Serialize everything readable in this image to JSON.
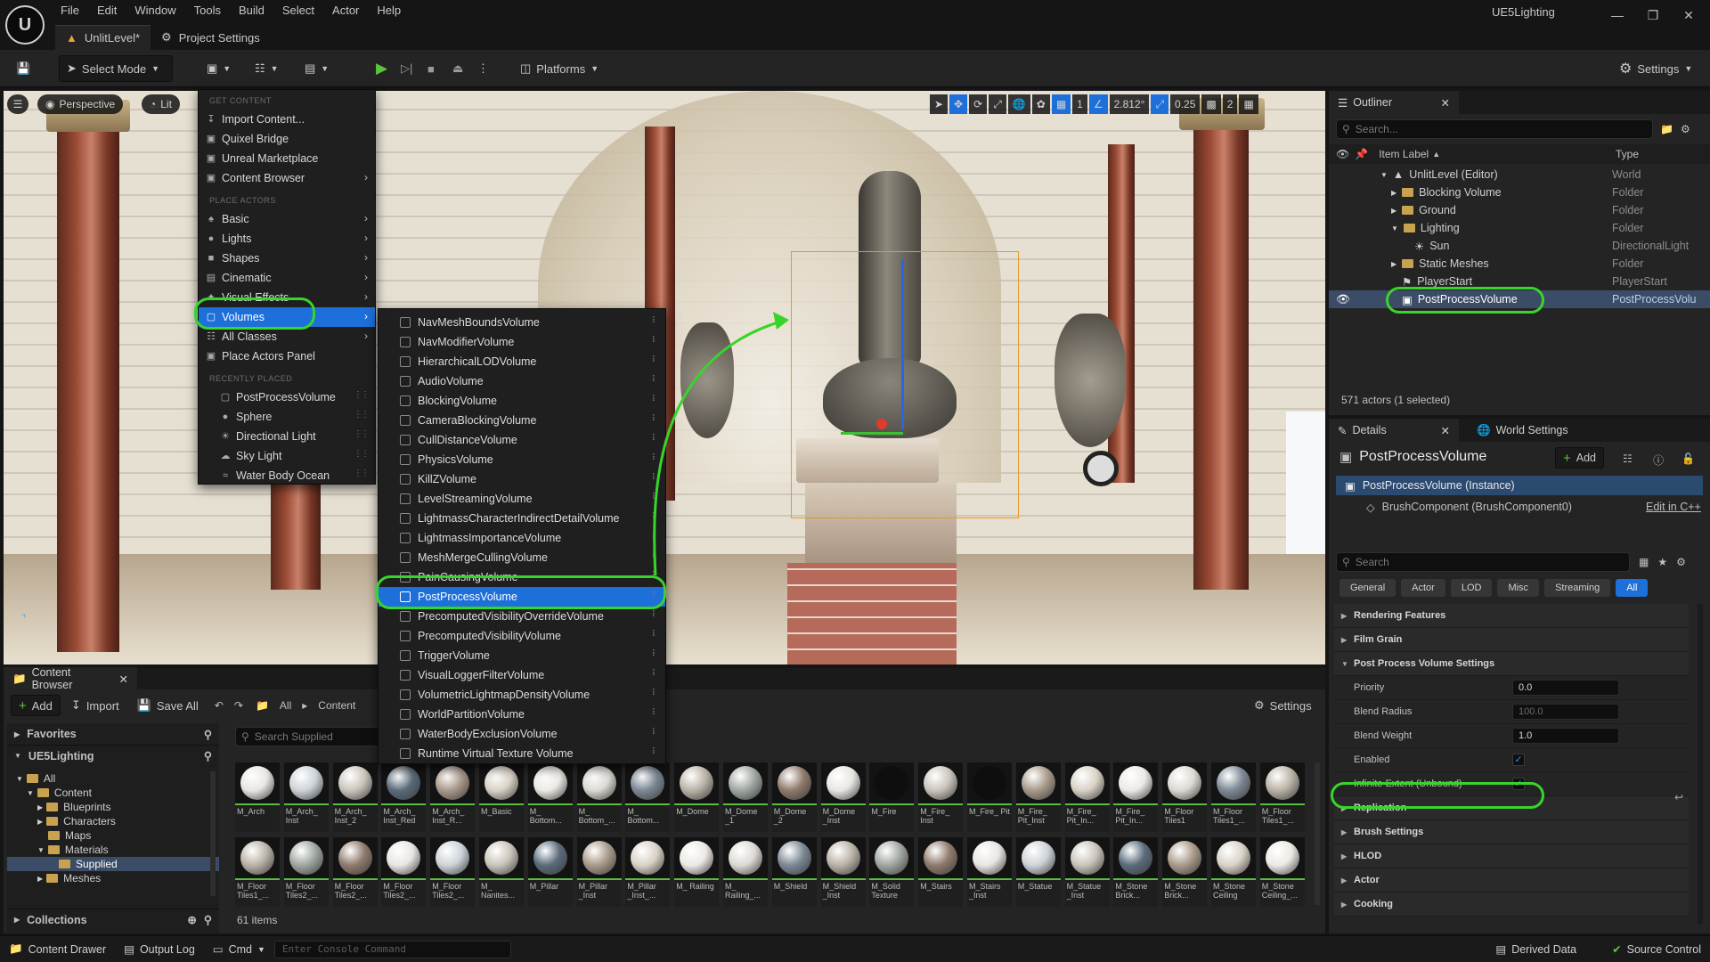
{
  "app": {
    "project_name": "UE5Lighting",
    "menu": [
      "File",
      "Edit",
      "Window",
      "Tools",
      "Build",
      "Select",
      "Actor",
      "Help"
    ],
    "doc_tabs": [
      {
        "label": "UnlitLevel*",
        "icon": "level-icon"
      },
      {
        "label": "Project Settings",
        "icon": "gear-icon"
      }
    ]
  },
  "toolbar": {
    "select_mode": "Select Mode",
    "platforms": "Platforms",
    "settings": "Settings"
  },
  "viewport": {
    "perspective": "Perspective",
    "lit": "Lit",
    "grid_snap": "1",
    "angle_snap": "2.812°",
    "scale_snap": "0.25",
    "camera_speed": "2"
  },
  "place_menu": {
    "section_get_content": "GET CONTENT",
    "get_content_items": [
      {
        "label": "Import Content...",
        "icon": "import-icon"
      },
      {
        "label": "Quixel Bridge",
        "icon": "bridge-icon"
      },
      {
        "label": "Unreal Marketplace",
        "icon": "marketplace-icon"
      },
      {
        "label": "Content Browser",
        "icon": "content-browser-icon"
      }
    ],
    "section_place_actors": "PLACE ACTORS",
    "place_items": [
      {
        "label": "Basic",
        "icon": "basic-icon"
      },
      {
        "label": "Lights",
        "icon": "light-bulb-icon"
      },
      {
        "label": "Shapes",
        "icon": "shapes-icon"
      },
      {
        "label": "Cinematic",
        "icon": "cinematic-icon"
      },
      {
        "label": "Visual Effects",
        "icon": "visual-effects-icon"
      },
      {
        "label": "Volumes",
        "icon": "volume-icon"
      },
      {
        "label": "All Classes",
        "icon": "all-classes-icon"
      },
      {
        "label": "Place Actors Panel",
        "icon": "place-actors-icon"
      }
    ],
    "section_recently_placed": "RECENTLY PLACED",
    "recent_items": [
      {
        "label": "PostProcessVolume",
        "icon": "postprocess-icon"
      },
      {
        "label": "Sphere",
        "icon": "sphere-icon"
      },
      {
        "label": "Directional Light",
        "icon": "directional-light-icon"
      },
      {
        "label": "Sky Light",
        "icon": "sky-light-icon"
      },
      {
        "label": "Water Body Ocean",
        "icon": "water-icon"
      }
    ]
  },
  "volumes_menu": {
    "items": [
      "NavMeshBoundsVolume",
      "NavModifierVolume",
      "HierarchicalLODVolume",
      "AudioVolume",
      "BlockingVolume",
      "CameraBlockingVolume",
      "CullDistanceVolume",
      "PhysicsVolume",
      "KillZVolume",
      "LevelStreamingVolume",
      "LightmassCharacterIndirectDetailVolume",
      "LightmassImportanceVolume",
      "MeshMergeCullingVolume",
      "PainCausingVolume",
      "PostProcessVolume",
      "PrecomputedVisibilityOverrideVolume",
      "PrecomputedVisibilityVolume",
      "TriggerVolume",
      "VisualLoggerFilterVolume",
      "VolumetricLightmapDensityVolume",
      "WorldPartitionVolume",
      "WaterBodyExclusionVolume",
      "Runtime Virtual Texture Volume"
    ],
    "selected": "PostProcessVolume"
  },
  "outliner": {
    "title": "Outliner",
    "search_placeholder": "Search...",
    "col_label": "Item Label",
    "col_type": "Type",
    "rows": [
      {
        "label": "UnlitLevel (Editor)",
        "type": "World",
        "indent": 0,
        "icon": "level-icon"
      },
      {
        "label": "Blocking Volume",
        "type": "Folder",
        "indent": 1,
        "icon": "folder-icon"
      },
      {
        "label": "Ground",
        "type": "Folder",
        "indent": 1,
        "icon": "folder-icon"
      },
      {
        "label": "Lighting",
        "type": "Folder",
        "indent": 1,
        "icon": "folder-icon"
      },
      {
        "label": "Sun",
        "type": "DirectionalLight",
        "indent": 2,
        "icon": "sun-icon"
      },
      {
        "label": "Static Meshes",
        "type": "Folder",
        "indent": 1,
        "icon": "folder-icon"
      },
      {
        "label": "PlayerStart",
        "type": "PlayerStart",
        "indent": 1,
        "icon": "player-start-icon"
      },
      {
        "label": "PostProcessVolume",
        "type": "PostProcessVolu",
        "indent": 1,
        "icon": "postprocess-icon"
      }
    ],
    "status": "571 actors (1 selected)"
  },
  "details": {
    "tab_details": "Details",
    "tab_world_settings": "World Settings",
    "actor_name": "PostProcessVolume",
    "add_label": "Add",
    "instance": "PostProcessVolume (Instance)",
    "component": "BrushComponent (BrushComponent0)",
    "edit_cpp": "Edit in C++",
    "search_placeholder": "Search",
    "filters": [
      "General",
      "Actor",
      "LOD",
      "Misc",
      "Streaming",
      "All"
    ],
    "sections": {
      "rendering_features": "Rendering Features",
      "film_grain": "Film Grain",
      "pp_settings": "Post Process Volume Settings",
      "replication": "Replication",
      "brush_settings": "Brush Settings",
      "hlod": "HLOD",
      "actor": "Actor",
      "cooking": "Cooking"
    },
    "props": {
      "priority_label": "Priority",
      "priority_value": "0.0",
      "blend_radius_label": "Blend Radius",
      "blend_radius_value": "100.0",
      "blend_weight_label": "Blend Weight",
      "blend_weight_value": "1.0",
      "enabled_label": "Enabled",
      "infinite_label": "Infinite Extent (Unbound)"
    }
  },
  "content_browser": {
    "title": "Content Browser",
    "add": "Add",
    "import": "Import",
    "save_all": "Save All",
    "path": [
      "All",
      "Content"
    ],
    "settings": "Settings",
    "favorites": "Favorites",
    "project": "UE5Lighting",
    "collections": "Collections",
    "search_placeholder": "Search Supplied",
    "item_count": "61 items",
    "tree": [
      {
        "label": "All",
        "indent": 0
      },
      {
        "label": "Content",
        "indent": 1
      },
      {
        "label": "Blueprints",
        "indent": 2
      },
      {
        "label": "Characters",
        "indent": 2
      },
      {
        "label": "Maps",
        "indent": 2
      },
      {
        "label": "Materials",
        "indent": 2
      },
      {
        "label": "Supplied",
        "indent": 3
      },
      {
        "label": "Meshes",
        "indent": 2
      }
    ],
    "assets_row1": [
      "M_Arch",
      "M_Arch_ Inst",
      "M_Arch_ Inst_2",
      "M_Arch_ Inst_Red",
      "M_Arch_ Inst_R...",
      "M_Basic",
      "M_ Bottom...",
      "M_ Bottom_...",
      "M_ Bottom...",
      "M_Dome",
      "M_Dome _1",
      "M_Dome _2",
      "M_Dome _Inst",
      "M_Fire",
      "M_Fire_ Inst",
      "M_Fire_ Pit",
      "M_Fire_ Pit_Inst",
      "M_Fire_ Pit_In...",
      "M_Fire_ Pit_In...",
      "M_Floor Tiles1",
      "M_Floor Tiles1_...",
      "M_Floor Tiles1_..."
    ],
    "assets_row2": [
      "M_Floor Tiles1_...",
      "M_Floor Tiles2_...",
      "M_Floor Tiles2_...",
      "M_Floor Tiles2_...",
      "M_Floor Tiles2_...",
      "M_ Nanites...",
      "M_Pillar",
      "M_Pillar _Inst",
      "M_Pillar _Inst_...",
      "M_ Railing",
      "M_ Railing_...",
      "M_Shield",
      "M_Shield _Inst",
      "M_Solid Texture",
      "M_Stairs",
      "M_Stairs _Inst",
      "M_Statue",
      "M_Statue _Inst",
      "M_Stone Brick...",
      "M_Stone Brick...",
      "M_Stone Ceiling",
      "M_Stone Ceiling_..."
    ]
  },
  "statusbar": {
    "content_drawer": "Content Drawer",
    "output_log": "Output Log",
    "cmd": "Cmd",
    "console_placeholder": "Enter Console Command",
    "derived_data": "Derived Data",
    "source_control": "Source Control"
  },
  "colors": {
    "highlight": "#39d42b",
    "selection": "#1d6fd9",
    "panel": "#242424"
  }
}
